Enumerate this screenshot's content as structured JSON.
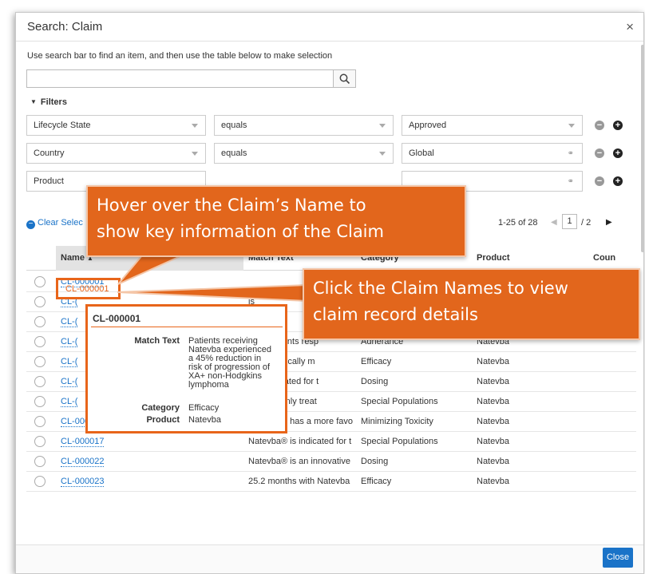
{
  "dialog": {
    "title": "Search: Claim",
    "close_glyph": "×",
    "instruction": "Use search bar to find an item, and then use the table below to make selection",
    "search_value": "",
    "search_icon": "search-icon"
  },
  "filters": {
    "label": "Filters",
    "rows": [
      {
        "field": "Lifecycle State",
        "operator": "equals",
        "value": "Approved",
        "value_control": "dropdown"
      },
      {
        "field": "Country",
        "operator": "equals",
        "value": "Global",
        "value_control": "lookup"
      },
      {
        "field": "Product",
        "operator": "",
        "value": "",
        "value_control": "lookup"
      }
    ]
  },
  "toolbar": {
    "clear_selection": "Clear Selec",
    "page_range": "1-25 of 28",
    "current_page": "1",
    "total_pages": "/ 2"
  },
  "table": {
    "columns": [
      "Name",
      "Match Text",
      "Category",
      "Product",
      "Coun"
    ],
    "sort_indicator": "▲",
    "rows": [
      {
        "name": "CL-000001",
        "match_text": "",
        "category": "",
        "product": ""
      },
      {
        "name": "CL-(",
        "match_text": "is",
        "category": "",
        "product": ""
      },
      {
        "name": "CL-(",
        "match_text": "d",
        "category": "",
        "product": ""
      },
      {
        "name": "CL-(",
        "match_text": "% of patients resp",
        "category": "Adherance",
        "product": "Natevba"
      },
      {
        "name": "CL-(",
        "match_text": "offers clinically m",
        "category": "Efficacy",
        "product": "Natevba"
      },
      {
        "name": "CL-(",
        "match_text": "® is indicated for t",
        "category": "Dosing",
        "product": "Natevba"
      },
      {
        "name": "CL-(",
        "match_text": "® is the only treat",
        "category": "Special Populations",
        "product": "Natevba"
      },
      {
        "name": "CL-000016",
        "match_text": "Natevba® has a more favo",
        "category": "Minimizing Toxicity",
        "product": "Natevba"
      },
      {
        "name": "CL-000017",
        "match_text": "Natevba® is indicated for t",
        "category": "Special Populations",
        "product": "Natevba"
      },
      {
        "name": "CL-000022",
        "match_text": "Natevba® is an innovative",
        "category": "Dosing",
        "product": "Natevba"
      },
      {
        "name": "CL-000023",
        "match_text": "25.2 months with Natevba",
        "category": "Efficacy",
        "product": "Natevba"
      }
    ]
  },
  "tooltip": {
    "title": "CL-000001",
    "match_text_label": "Match Text",
    "match_text_lines": [
      "Patients receiving",
      "Natevba experienced",
      "a 45% reduction in",
      "risk of progression of",
      "XA+ non-Hodgkins",
      "lymphoma"
    ],
    "category_label": "Category",
    "category_value": "Efficacy",
    "product_label": "Product",
    "product_value": "Natevba"
  },
  "callouts": {
    "hover_lines": [
      "Hover over the Claim’s Name to",
      "show key information of the Claim"
    ],
    "click_lines": [
      "Click the Claim Names to view",
      "claim record details"
    ]
  },
  "footer": {
    "close_label": "Close"
  },
  "colors": {
    "accent": "#1a73c8",
    "callout": "#e2661c",
    "highlight": "#e8651a"
  }
}
